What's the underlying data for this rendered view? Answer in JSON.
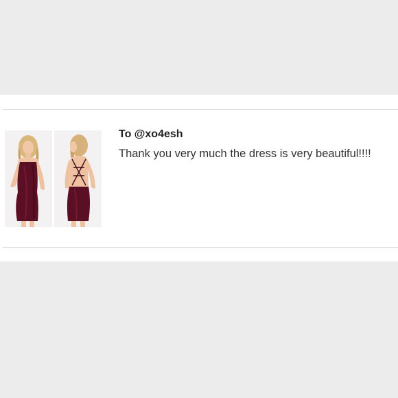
{
  "note": {
    "recipient": "To @xo4esh",
    "message": "Thank you very much the dress is very beautiful!!!!"
  },
  "photos": [
    {
      "view": "front",
      "icon": "dress-front-photo"
    },
    {
      "view": "back",
      "icon": "dress-back-photo"
    }
  ],
  "colors": {
    "page_background": "#ececec",
    "card_background": "#ffffff",
    "dress": "#5a0f24",
    "text": "#333333"
  }
}
